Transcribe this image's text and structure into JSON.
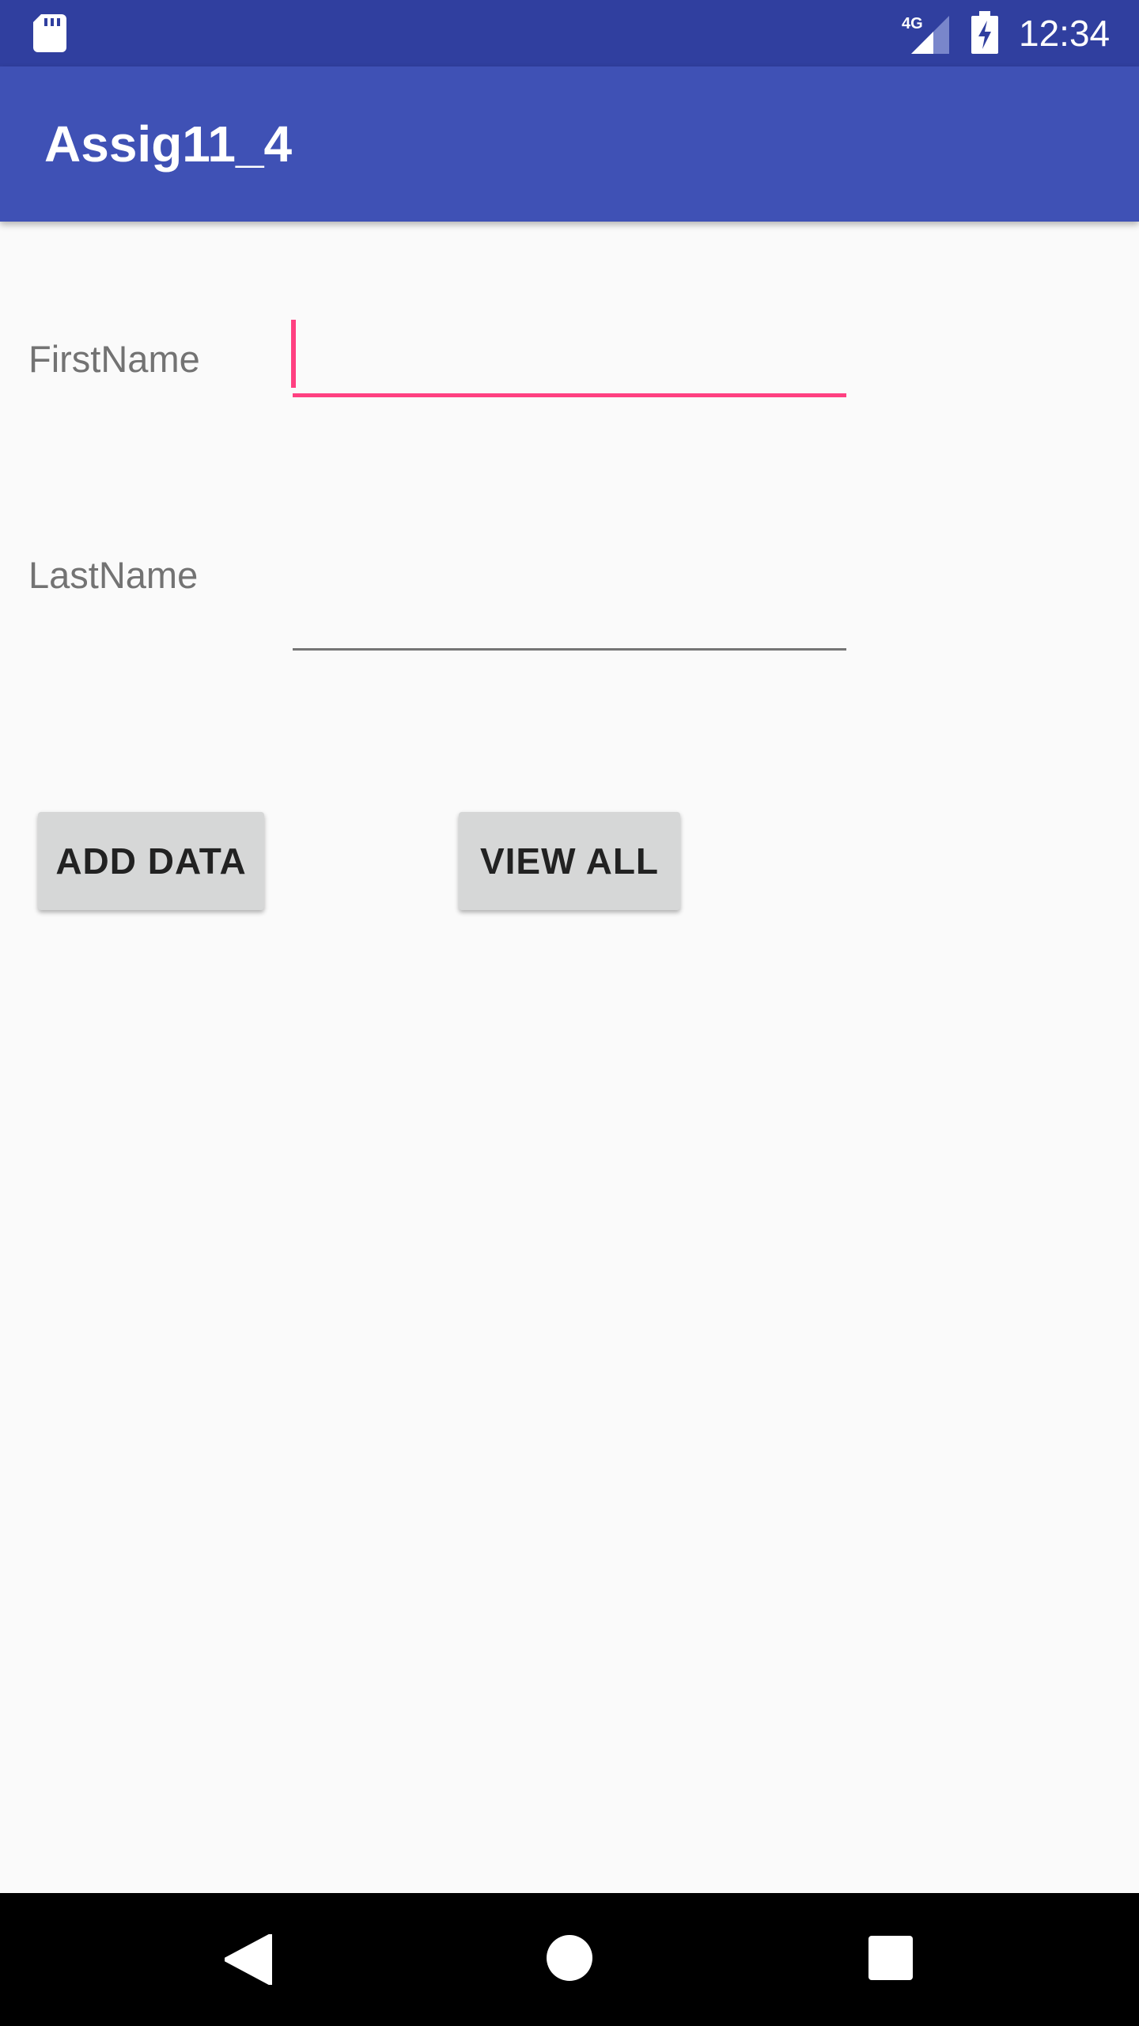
{
  "status_bar": {
    "time": "12:34",
    "network": "4G",
    "icons": [
      "sd-card-icon",
      "signal-icon",
      "battery-charging-icon"
    ]
  },
  "app_bar": {
    "title": "Assig11_4",
    "color": "#3f51b5"
  },
  "form": {
    "first_name": {
      "label": "FirstName",
      "value": ""
    },
    "last_name": {
      "label": "LastName",
      "value": ""
    }
  },
  "buttons": {
    "add_data": "ADD DATA",
    "view_all": "VIEW ALL"
  },
  "nav_bar": {
    "icons": [
      "back-icon",
      "home-icon",
      "recents-icon"
    ]
  },
  "colors": {
    "status_bar": "#303f9f",
    "primary": "#3f51b5",
    "accent": "#ff4081",
    "background": "#fafafa",
    "button": "#d6d7d7"
  }
}
